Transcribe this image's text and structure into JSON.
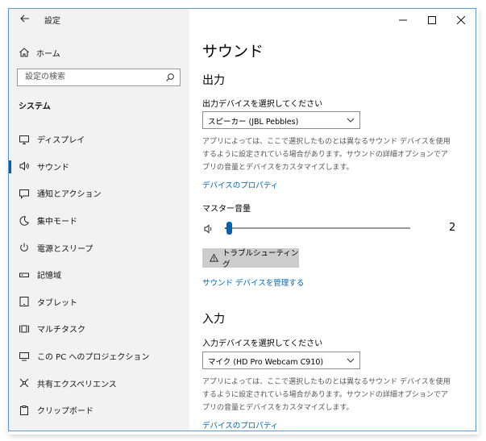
{
  "window": {
    "title": "設定"
  },
  "sidebar": {
    "home_label": "ホーム",
    "search_placeholder": "設定の検索",
    "section_title": "システム",
    "items": [
      {
        "label": "ディスプレイ",
        "icon": "monitor-icon"
      },
      {
        "label": "サウンド",
        "icon": "speaker-icon",
        "active": true
      },
      {
        "label": "通知とアクション",
        "icon": "notification-icon"
      },
      {
        "label": "集中モード",
        "icon": "moon-icon"
      },
      {
        "label": "電源とスリープ",
        "icon": "power-icon"
      },
      {
        "label": "記憶域",
        "icon": "storage-icon"
      },
      {
        "label": "タブレット",
        "icon": "tablet-icon"
      },
      {
        "label": "マルチタスク",
        "icon": "multitask-icon"
      },
      {
        "label": "この PC へのプロジェクション",
        "icon": "projection-icon"
      },
      {
        "label": "共有エクスペリエンス",
        "icon": "share-icon"
      },
      {
        "label": "クリップボード",
        "icon": "clipboard-icon"
      }
    ]
  },
  "main": {
    "title": "サウンド",
    "output": {
      "heading": "出力",
      "device_label": "出力デバイスを選択してください",
      "device_value": "スピーカー (JBL Pebbles)",
      "description": "アプリによっては、ここで選択したものとは異なるサウンド デバイスを使用するように設定されている場合があります。サウンドの詳細オプションでアプリの音量とデバイスをカスタマイズします。",
      "properties_link": "デバイスのプロパティ",
      "volume_label": "マスター音量",
      "volume_value": "2",
      "volume_level": 0.02,
      "troubleshoot_label": "トラブルシューティング",
      "manage_link": "サウンド デバイスを管理する"
    },
    "input": {
      "heading": "入力",
      "device_label": "入力デバイスを選択してください",
      "device_value": "マイク (HD Pro Webcam C910)",
      "description": "アプリによっては、ここで選択したものとは異なるサウンド デバイスを使用するように設定されている場合があります。サウンドの詳細オプションでアプリの音量とデバイスをカスタマイズします。",
      "properties_link": "デバイスのプロパティ"
    }
  },
  "colors": {
    "accent": "#0063b1",
    "link": "#0067b8",
    "sidebar_bg": "#f2f2f2"
  }
}
